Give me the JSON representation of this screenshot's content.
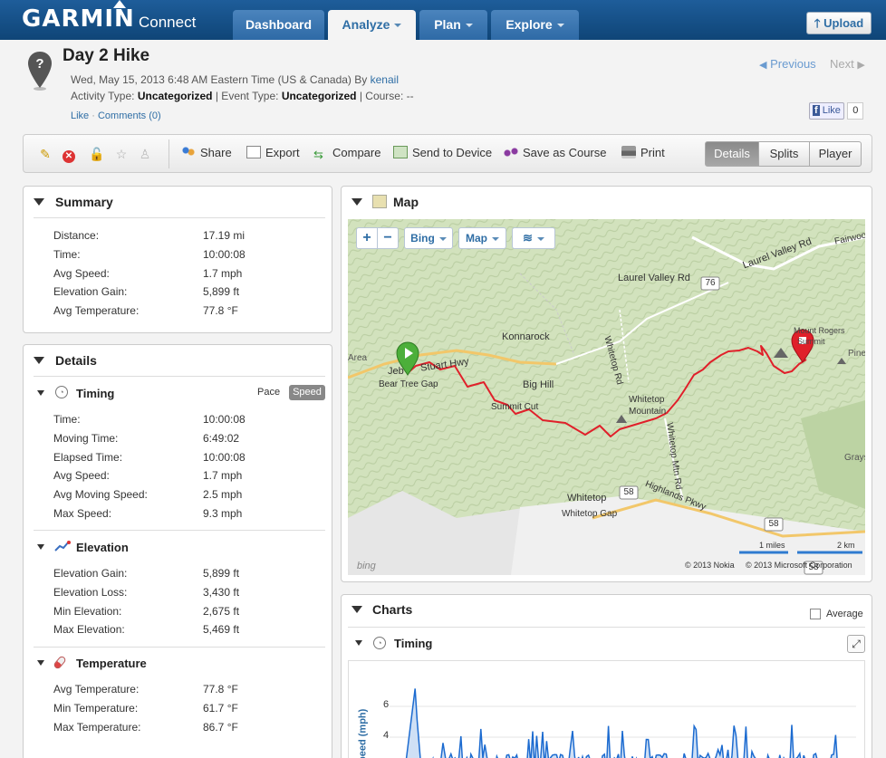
{
  "header": {
    "brand": "GARMIN",
    "brand_sub": "Connect",
    "tabs": [
      "Dashboard",
      "Analyze",
      "Plan",
      "Explore"
    ],
    "upload_label": "Upload"
  },
  "activity": {
    "title": "Day 2 Hike",
    "datetime_text": "Wed, May 15, 2013 6:48 AM Eastern Time (US & Canada) By",
    "author": "kenail",
    "activity_type_label": "Activity Type:",
    "activity_type": "Uncategorized",
    "event_type_label": "| Event Type:",
    "event_type": "Uncategorized",
    "course_label": "| Course: --",
    "like": "Like",
    "comments": "Comments (0)",
    "previous": "Previous",
    "next": "Next",
    "fb_like": "Like",
    "fb_count": "0"
  },
  "toolbar": {
    "share": "Share",
    "export": "Export",
    "compare": "Compare",
    "send": "Send to Device",
    "save_course": "Save as Course",
    "print": "Print",
    "views": [
      "Details",
      "Splits",
      "Player"
    ]
  },
  "summary": {
    "title": "Summary",
    "rows": [
      {
        "label": "Distance:",
        "value": "17.19 mi"
      },
      {
        "label": "Time:",
        "value": "10:00:08"
      },
      {
        "label": "Avg Speed:",
        "value": "1.7 mph"
      },
      {
        "label": "Elevation Gain:",
        "value": "5,899 ft"
      },
      {
        "label": "Avg Temperature:",
        "value": "77.8 °F"
      }
    ]
  },
  "details": {
    "title": "Details",
    "timing": {
      "title": "Timing",
      "pace": "Pace",
      "speed": "Speed",
      "rows": [
        {
          "label": "Time:",
          "value": "10:00:08"
        },
        {
          "label": "Moving Time:",
          "value": "6:49:02"
        },
        {
          "label": "Elapsed Time:",
          "value": "10:00:08"
        },
        {
          "label": "Avg Speed:",
          "value": "1.7 mph"
        },
        {
          "label": "Avg Moving Speed:",
          "value": "2.5 mph"
        },
        {
          "label": "Max Speed:",
          "value": "9.3 mph"
        }
      ]
    },
    "elevation": {
      "title": "Elevation",
      "rows": [
        {
          "label": "Elevation Gain:",
          "value": "5,899 ft"
        },
        {
          "label": "Elevation Loss:",
          "value": "3,430 ft"
        },
        {
          "label": "Min Elevation:",
          "value": "2,675 ft"
        },
        {
          "label": "Max Elevation:",
          "value": "5,469 ft"
        }
      ]
    },
    "temperature": {
      "title": "Temperature",
      "rows": [
        {
          "label": "Avg Temperature:",
          "value": "77.8 °F"
        },
        {
          "label": "Min Temperature:",
          "value": "61.7 °F"
        },
        {
          "label": "Max Temperature:",
          "value": "86.7 °F"
        }
      ]
    }
  },
  "map": {
    "title": "Map",
    "zoom_in": "+",
    "zoom_out": "−",
    "provider": "Bing",
    "type": "Map",
    "labels": {
      "konnarock": "Konnarock",
      "laurel_valley": "Laurel Valley Rd",
      "laurel_valley2": "Laurel Valley Rd",
      "whitetop_rd": "Whitetop Rd",
      "jeb": "Jeb",
      "stuart": "Stuart Hwy",
      "bear_tree": "Bear Tree Gap",
      "big_hill": "Big Hill",
      "summit_cut": "Summit Cut",
      "whitetop_mtn": "Whitetop",
      "mountain": "Mountain",
      "whitetop_mtn_rd": "Whitetop Mtn Rd",
      "whitetop": "Whitetop",
      "whitetop_gap": "Whitetop Gap",
      "highlands": "Highlands Pkwy",
      "mount_rogers": "Mount Rogers",
      "mount_rogers2": "Summit",
      "pine": "Pine",
      "fairwood": "Fairwoo",
      "grays": "Grays",
      "area": "Area",
      "r76": "76",
      "r58a": "58",
      "r58b": "58",
      "r58c": "58",
      "scale_mi": "1 miles",
      "scale_km": "2 km",
      "copy1": "© 2013 Nokia",
      "copy2": "© 2013 Microsoft Corporation",
      "bing": "bing"
    }
  },
  "charts": {
    "title": "Charts",
    "average": "Average",
    "timing_title": "Timing",
    "ylabel": "Speed (mph)",
    "yticks": [
      "6",
      "4"
    ]
  },
  "colors": {
    "header_blue": "#1e5d9a",
    "link_blue": "#2f6ea5",
    "track_red": "#e0202a",
    "chart_blue": "#1c6bd0"
  }
}
